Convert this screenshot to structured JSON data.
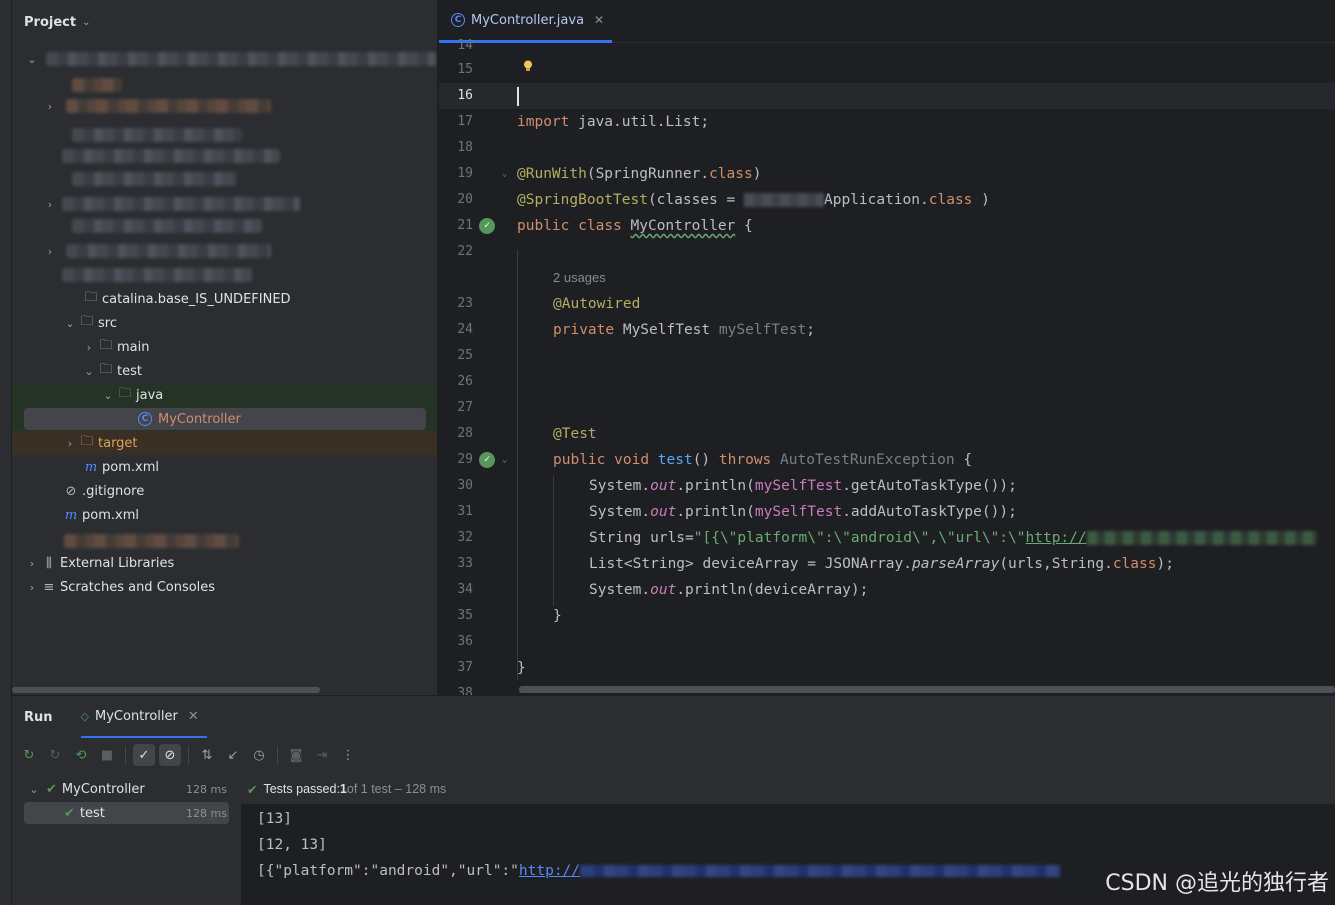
{
  "project": {
    "title": "Project",
    "tree": [
      {
        "label": "catalina.base_IS_UNDEFINED"
      },
      {
        "label": "src"
      },
      {
        "label": "main"
      },
      {
        "label": "test"
      },
      {
        "label": "java"
      },
      {
        "label": "MyController"
      },
      {
        "label": "target"
      },
      {
        "label": "pom.xml"
      },
      {
        "label": ".gitignore"
      },
      {
        "label": "pom.xml"
      },
      {
        "label": "External Libraries"
      },
      {
        "label": "Scratches and Consoles"
      }
    ]
  },
  "editor": {
    "tab_label": "MyController.java",
    "line_numbers": [
      "14",
      "15",
      "16",
      "17",
      "18",
      "19",
      "20",
      "21",
      "22",
      "23",
      "24",
      "25",
      "26",
      "27",
      "28",
      "29",
      "30",
      "31",
      "32",
      "33",
      "34",
      "35",
      "36",
      "37",
      "38"
    ],
    "usages_hint": "2 usages",
    "code": {
      "l17_kw": "import",
      "l17_rest": " java.util.List;",
      "l19_ann": "@RunWith",
      "l19_rest1": "(SpringRunner.",
      "l19_kw": "class",
      "l19_rest2": ")",
      "l20_ann": "@SpringBootTest",
      "l20_rest1": "(classes = ",
      "l20_rest2": "Application.",
      "l20_kw": "class",
      "l20_rest3": " )",
      "l21_kw1": "public",
      "l21_kw2": "class",
      "l21_name": "MyController",
      "l21_rest": " {",
      "l23_ann": "@Autowired",
      "l24_kw": "private",
      "l24_type": " MySelfTest ",
      "l24_field": "mySelfTest",
      "l24_rest": ";",
      "l28_ann": "@Test",
      "l29_kw1": "public",
      "l29_kw2": "void",
      "l29_fn": "test",
      "l29_rest1": "() ",
      "l29_kw3": "throws",
      "l29_exc": "AutoTestRunException",
      "l29_rest2": " {",
      "l30_a": "System.",
      "l30_out": "out",
      "l30_b": ".println(",
      "l30_f": "mySelfTest",
      "l30_c": ".getAutoTaskType());",
      "l31_a": "System.",
      "l31_out": "out",
      "l31_b": ".println(",
      "l31_f": "mySelfTest",
      "l31_c": ".addAutoTaskType());",
      "l32_a": "String urls=",
      "l32_str": "\"[{\\\"platform\\\":\\\"android\\\",\\\"url\\\":\\\"",
      "l32_link": "http://",
      "l33_a": "List<String> deviceArray = JSONArray.",
      "l33_fn": "parseArray",
      "l33_b": "(urls,String.",
      "l33_kw": "class",
      "l33_c": ");",
      "l34_a": "System.",
      "l34_out": "out",
      "l34_b": ".println(deviceArray);",
      "l35": "}",
      "l37": "}"
    }
  },
  "run": {
    "title": "Run",
    "tab_label": "MyController",
    "tree": [
      {
        "label": "MyController",
        "time": "128 ms"
      },
      {
        "label": "test",
        "time": "128 ms"
      }
    ],
    "status_prefix": "Tests passed: ",
    "status_count": "1",
    "status_suffix": " of 1 test – 128 ms",
    "output": [
      "[13]",
      "[12, 13]",
      "[{\"platform\":\"android\",\"url\":\""
    ],
    "output_link": "http://"
  },
  "watermark": "CSDN @追光的独行者"
}
